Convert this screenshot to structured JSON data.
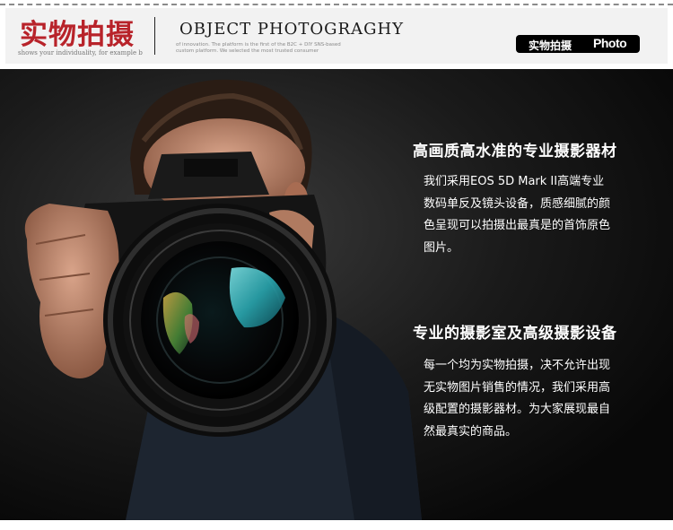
{
  "header": {
    "title_cn": "实物拍摄",
    "subtitle": "shows your individuality, for example b",
    "title_en": "OBJECT  PHOTOGRAGHY",
    "desc_line1": "of innovation. The platform is the first of the B2C + DIY SNS-based",
    "desc_line2": "custom platform. We selected the most trusted consumer",
    "badge_cn": "实物拍摄",
    "badge_en": "Photo"
  },
  "sections": [
    {
      "heading": "高画质高水准的专业摄影器材",
      "lines": [
        "我们采用EOS 5D Mark II高端专业",
        "数码单反及镜头设备，质感细腻的颜",
        "色呈现可以拍摄出最真是的首饰原色",
        "图片。"
      ]
    },
    {
      "heading": "专业的摄影室及高级摄影设备",
      "lines": [
        "每一个均为实物拍摄，决不允许出现",
        "无实物图片销售的情况，我们采用高",
        "级配置的摄影器材。为大家展现最自",
        "然最真实的商品。"
      ]
    }
  ]
}
